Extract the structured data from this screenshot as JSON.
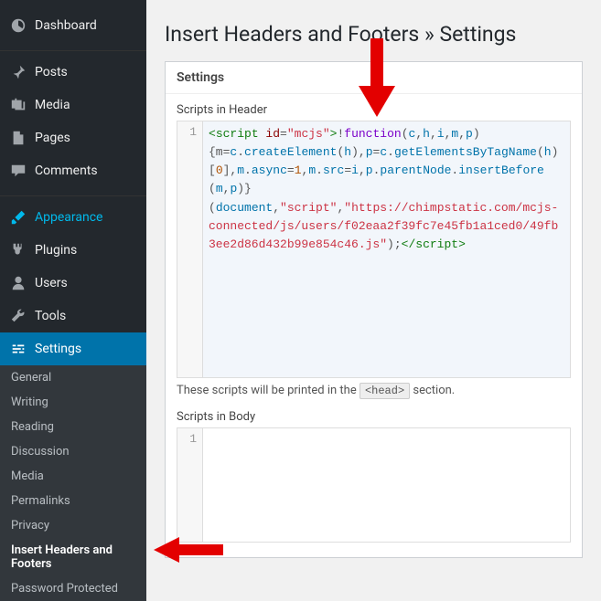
{
  "sidebar": {
    "items": [
      {
        "label": "Dashboard"
      },
      {
        "label": "Posts"
      },
      {
        "label": "Media"
      },
      {
        "label": "Pages"
      },
      {
        "label": "Comments"
      },
      {
        "label": "Appearance"
      },
      {
        "label": "Plugins"
      },
      {
        "label": "Users"
      },
      {
        "label": "Tools"
      },
      {
        "label": "Settings"
      }
    ],
    "sub": [
      {
        "label": "General"
      },
      {
        "label": "Writing"
      },
      {
        "label": "Reading"
      },
      {
        "label": "Discussion"
      },
      {
        "label": "Media"
      },
      {
        "label": "Permalinks"
      },
      {
        "label": "Privacy"
      },
      {
        "label": "Insert Headers and Footers"
      },
      {
        "label": "Password Protected"
      }
    ]
  },
  "page_title": "Insert Headers and Footers » Settings",
  "settings": {
    "heading": "Settings",
    "header_label": "Scripts in Header",
    "body_label": "Scripts in Body",
    "gutter_one": "1",
    "desc_prefix": "These scripts will be printed in the ",
    "desc_tag": "<head>",
    "desc_suffix": " section."
  },
  "code": {
    "t1": "<",
    "t2": "script",
    "t3": " id",
    "t4": "=",
    "t5": "\"mcjs\"",
    "t6": ">",
    "t7": "!",
    "t8": "function",
    "t9": "(",
    "t10": "c",
    "t11": ",",
    "t12": "h",
    "t13": ",",
    "t14": "i",
    "t15": ",",
    "t16": "m",
    "t17": ",",
    "t18": "p",
    "t19": ")",
    "t20": "{m",
    "t21": "=",
    "t22": "c",
    "t23": ".",
    "t24": "createElement",
    "t25": "(",
    "t26": "h",
    "t27": "),",
    "t28": "p",
    "t29": "=",
    "t30": "c",
    "t31": ".",
    "t32": "getElementsByTagName",
    "t33": "(",
    "t34": "h",
    "t35": ")",
    "t36": "[",
    "t37": "0",
    "t38": "],",
    "t39": "m",
    "t40": ".",
    "t41": "async",
    "t42": "=",
    "t43": "1",
    "t44": ",",
    "t45": "m",
    "t46": ".",
    "t47": "src",
    "t48": "=",
    "t49": "i",
    "t50": ",",
    "t51": "p",
    "t52": ".",
    "t53": "parentNode",
    "t54": ".",
    "t55": "insertBefore",
    "t56": "(",
    "t57": "m",
    "t58": ",",
    "t59": "p",
    "t60": ")}",
    "t61": "(",
    "t62": "document",
    "t63": ",",
    "t64": "\"script\"",
    "t65": ",",
    "t66": "\"https://chimpstatic.com/mcjs-connected/js/users/f02eaa2f39fc7e45fb1a1ced0/49fb3ee2d86d432b99e854c46.js\"",
    "t67": ");",
    "t68": "</",
    "t69": "script",
    "t70": ">"
  }
}
